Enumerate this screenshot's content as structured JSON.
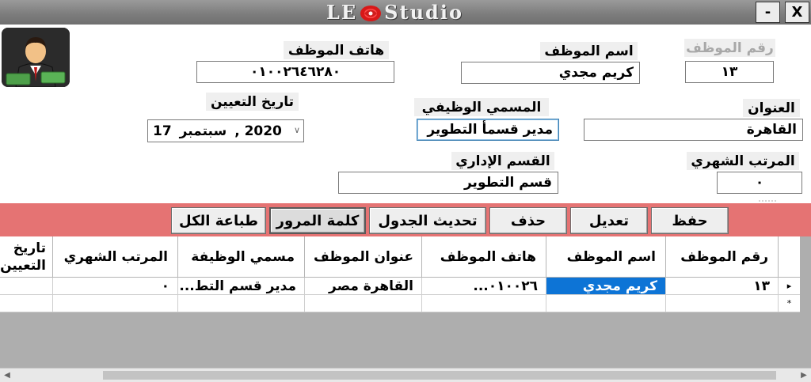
{
  "window": {
    "title_left": "LE",
    "title_right": "Studio",
    "minimize_label": "-",
    "close_label": "X",
    "logo_icon": "rose-flower-icon"
  },
  "form": {
    "emp_id_label": "رقم الموظف",
    "emp_id_value": "١٣",
    "emp_name_label": "اسم الموظف",
    "emp_name_value": "كريم مجدي",
    "emp_phone_label": "هاتف الموظف",
    "emp_phone_value": "٠١٠٠٢٦٤٦٢٨٠",
    "address_label": "العنوان",
    "address_value": "القاهرة",
    "job_title_label": "المسمي الوظيفي",
    "job_title_value": "مدير قسمأ التطوير",
    "hire_date_label": "تاريخ التعيين",
    "hire_date_day": "17",
    "hire_date_month": "سبتمبر",
    "hire_date_year": ", 2020",
    "salary_label": "المرتب الشهري",
    "salary_value": "٠",
    "department_label": "القسم الإداري",
    "department_value": "قسم التطوير"
  },
  "toolbar": {
    "save": "حفظ",
    "edit": "تعديل",
    "delete": "حذف",
    "refresh": "تحديث الجدول",
    "password": "كلمة المرور",
    "print_all": "طباعة الكل"
  },
  "table": {
    "headers": {
      "id": "رقم الموظف",
      "name": "اسم الموظف",
      "phone": "هاتف الموظف",
      "address": "عنوان الموظف",
      "job": "مسمي الوظيفة",
      "salary": "المرتب الشهري",
      "hire": "تاريخ التعيين"
    },
    "rows": [
      {
        "id": "١٣",
        "name": "كريم مجدي",
        "phone": "٠١٠٠٢٦...",
        "address": "القاهرة مصر",
        "job": "مدير قسم التط...",
        "salary": "٠",
        "hire": ""
      }
    ],
    "current_row_marker": "▸",
    "new_row_marker": "*"
  },
  "colors": {
    "toolbar_strip": "#e57373",
    "selection": "#0d74d6",
    "titlebar": "#7c7c7c"
  }
}
